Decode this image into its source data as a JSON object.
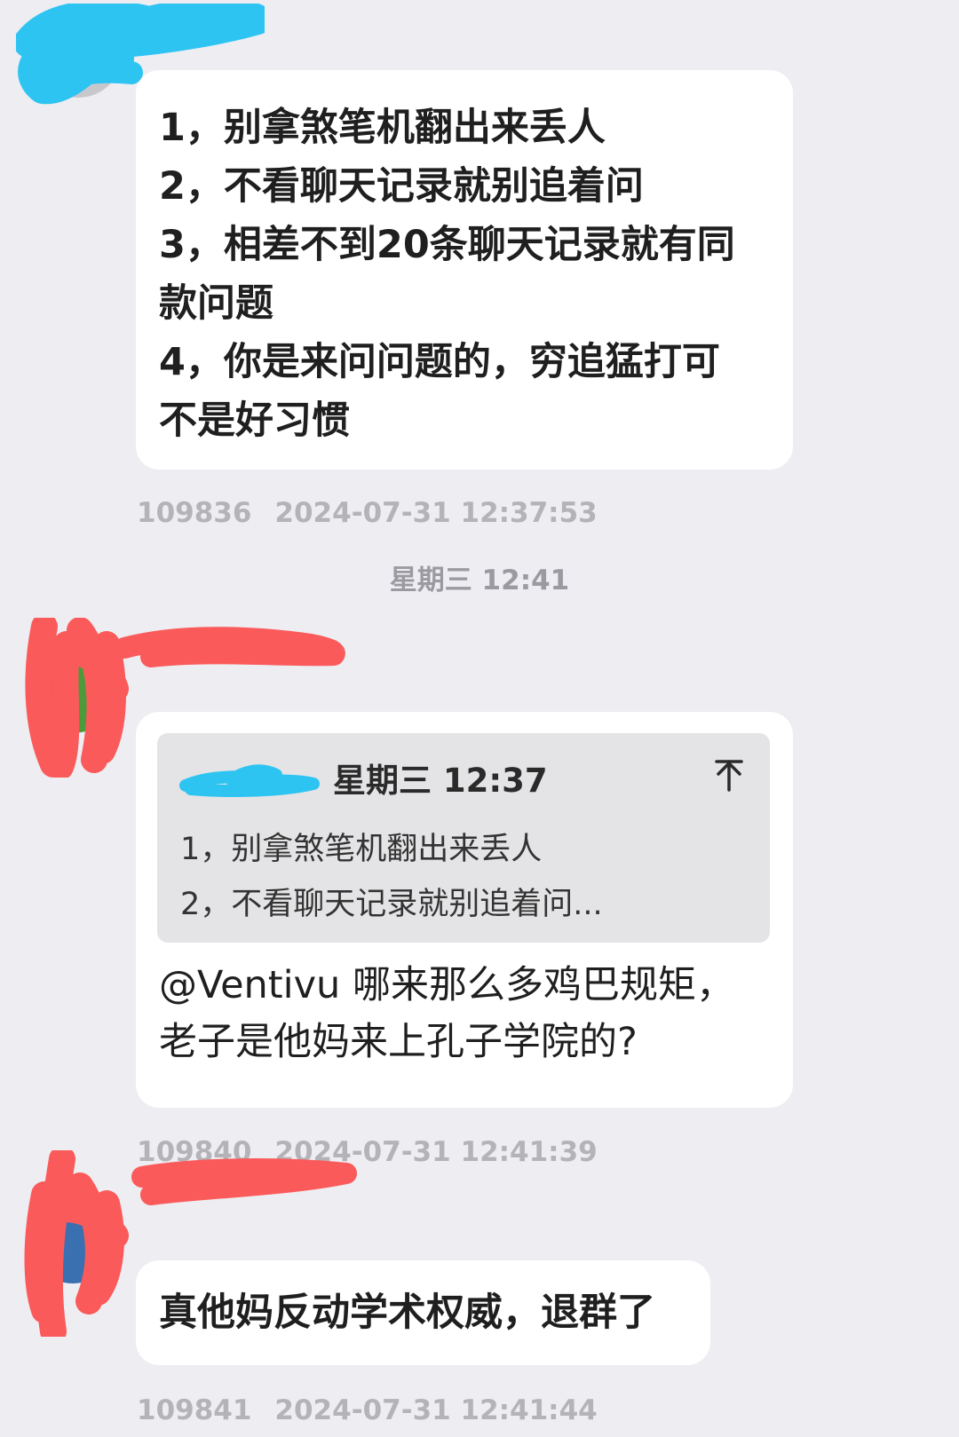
{
  "colors": {
    "background": "#ededf2",
    "bubble": "#ffffff",
    "quote_background": "#e4e4e6",
    "meta_text": "#b3b3b8",
    "redact_blue": "#2ec4f2",
    "redact_red": "#fb5a5a"
  },
  "messages": [
    {
      "text": "1，别拿煞笔机翻出来丢人\n2，不看聊天记录就别追着问\n3，相差不到20条聊天记录就有同\n款问题\n4，你是来问问题的，穷追猛打可\n不是好习惯",
      "id": "109836",
      "timestamp": "2024-07-31 12:37:53"
    },
    {
      "quote": {
        "time": "星期三 12:37",
        "line1": "1，别拿煞笔机翻出来丢人",
        "line2": "2，不看聊天记录就别追着问...",
        "icon": "jump-to-top-icon"
      },
      "text": "@Ventivu 哪来那么多鸡巴规矩，\n老子是他妈来上孔子学院的?",
      "id": "109840",
      "timestamp": "2024-07-31 12:41:39"
    },
    {
      "text": "真他妈反动学术权威，退群了",
      "id": "109841",
      "timestamp": "2024-07-31 12:41:44"
    }
  ],
  "divider": {
    "time": "星期三 12:41"
  }
}
